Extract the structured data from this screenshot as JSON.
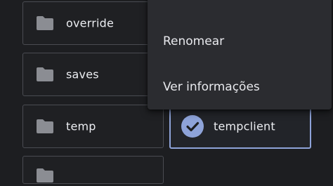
{
  "folders": [
    {
      "name": "override"
    },
    {
      "name": "saves"
    },
    {
      "name": "temp"
    },
    {
      "name": "tempclient",
      "selected": true
    }
  ],
  "context_menu": {
    "items": [
      {
        "label": "Renomear"
      },
      {
        "label": "Ver informações"
      }
    ]
  },
  "colors": {
    "background": "#1d1e21",
    "tile_border": "#4a4c52",
    "selected_border": "#8ea3d9",
    "check_fill": "#8ea3d9",
    "folder_icon": "#8b8d93",
    "menu_background": "#2b2c30"
  },
  "icons": {
    "folder": "folder-icon",
    "selected": "checkmark-circle-icon"
  }
}
